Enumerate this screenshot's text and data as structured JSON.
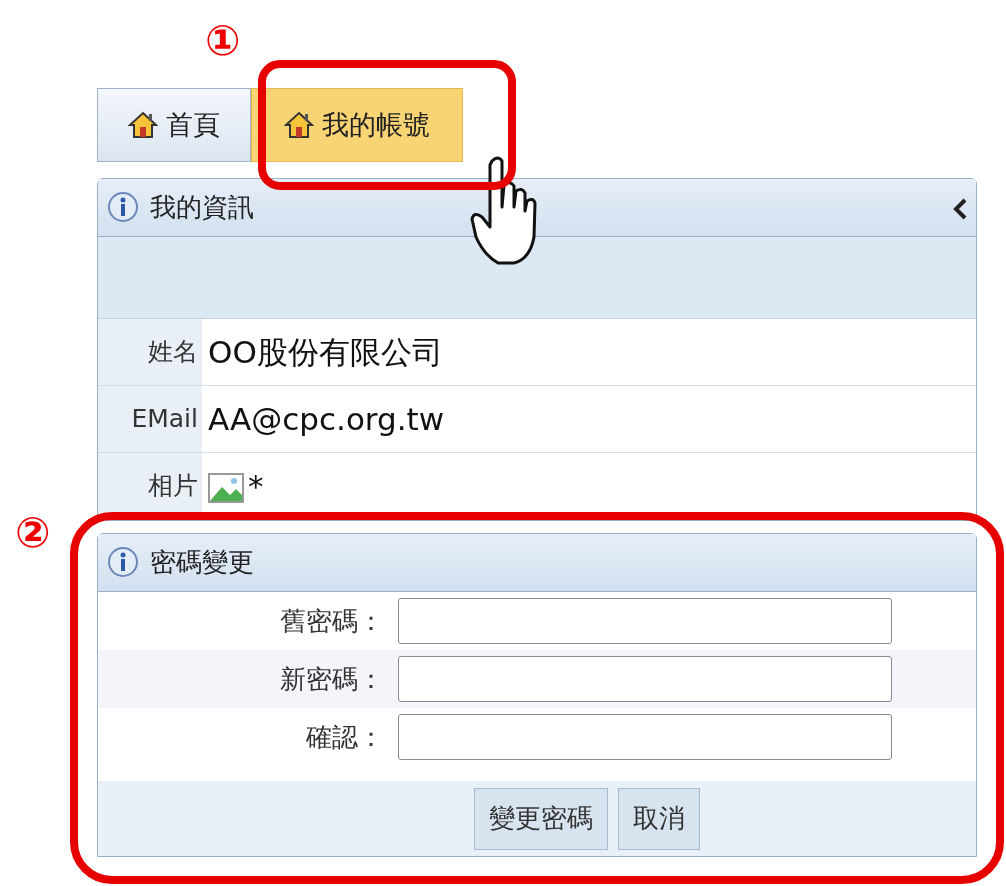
{
  "annotations": [
    {
      "label": "①"
    },
    {
      "label": "②"
    }
  ],
  "tabs": [
    {
      "label": "首頁",
      "selected": false
    },
    {
      "label": "我的帳號",
      "selected": true
    }
  ],
  "info_panel": {
    "title": "我的資訊",
    "fields": [
      {
        "label": "姓名",
        "kind": "text",
        "value": "OO股份有限公司"
      },
      {
        "label": "EMail",
        "kind": "text",
        "value": "AA@cpc.org.tw"
      },
      {
        "label": "相片",
        "kind": "image",
        "value": "*"
      }
    ]
  },
  "password_panel": {
    "title": "密碼變更",
    "fields": [
      {
        "label": "舊密碼："
      },
      {
        "label": "新密碼："
      },
      {
        "label": "確認："
      }
    ],
    "buttons": [
      "變更密碼",
      "取消"
    ]
  }
}
